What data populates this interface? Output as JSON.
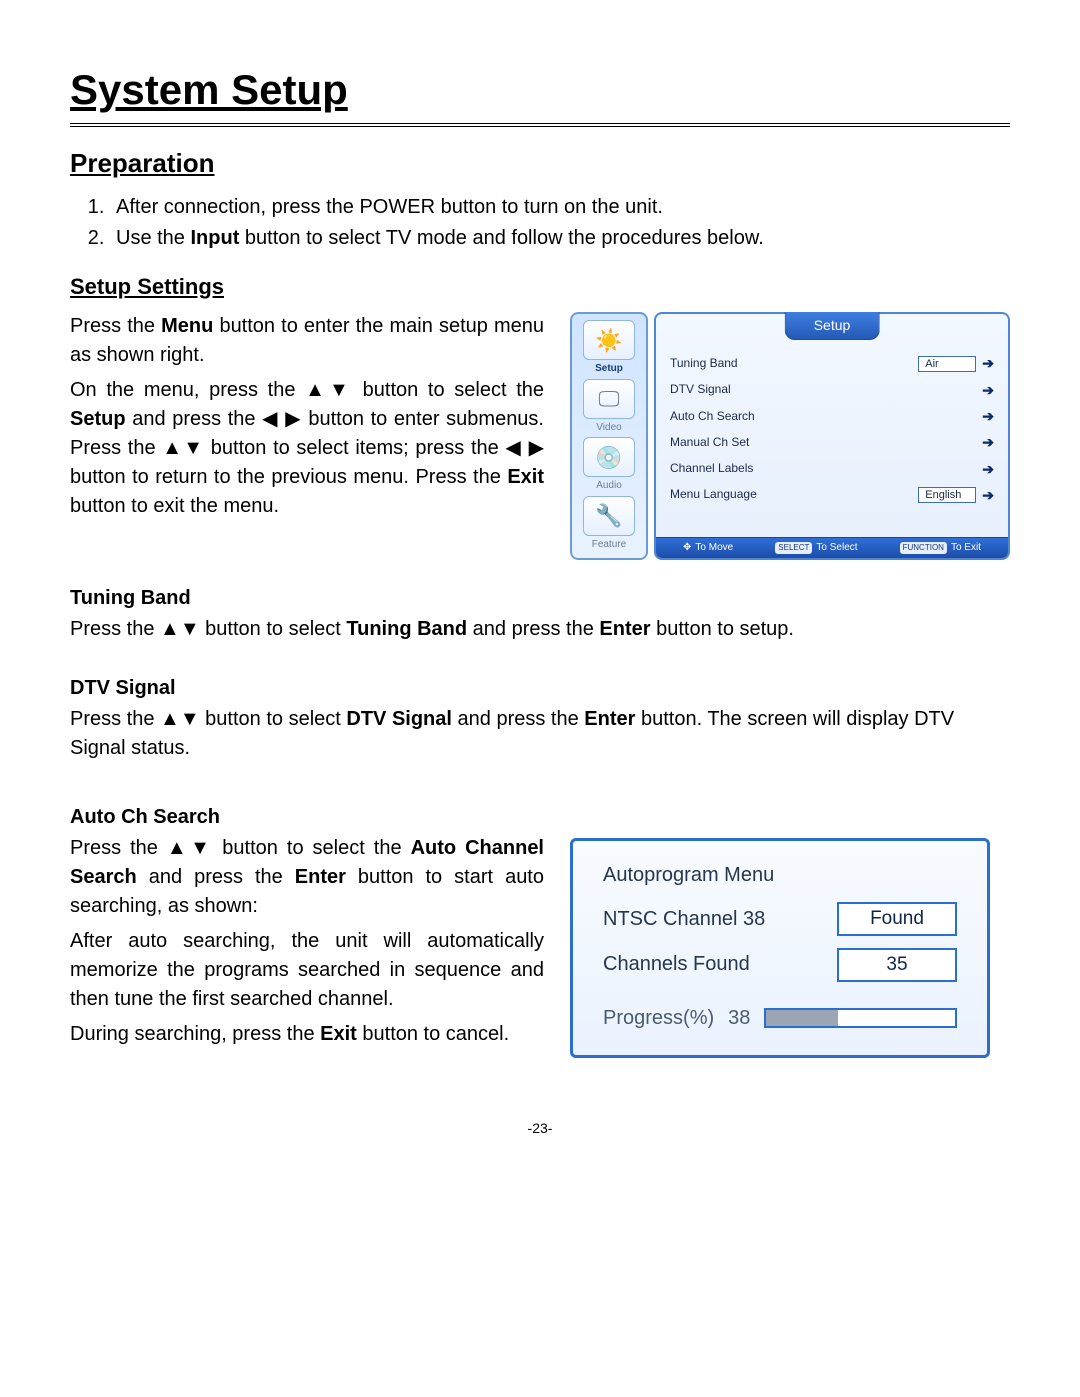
{
  "page": {
    "title": "System Setup",
    "heading_preparation": "Preparation",
    "steps": {
      "s1": "After connection, press the POWER button to turn on the unit.",
      "s2_a": "Use the ",
      "s2_b": "Input",
      "s2_c": " button to select TV mode and follow the procedures below."
    },
    "heading_setup_settings": "Setup Settings",
    "intro_p1_a": "Press the ",
    "intro_p1_b": "Menu",
    "intro_p1_c": " button to enter the main setup menu as shown right.",
    "intro_p2_a": "On the menu, press the ▲▼ button to select the ",
    "intro_p2_b": "Setup",
    "intro_p2_c": " and press the ◀ ▶ button to enter submenus. Press the ▲▼ button to select items; press the ◀ ▶ button to return to the previous menu. Press the ",
    "intro_p2_d": "Exit",
    "intro_p2_e": " button to exit the menu.",
    "sub_tuning_band_head": "Tuning Band",
    "sub_tuning_band_a": "Press the ▲▼ button to select ",
    "sub_tuning_band_b": "Tuning Band",
    "sub_tuning_band_c": " and press the ",
    "sub_tuning_band_d": "Enter",
    "sub_tuning_band_e": " button to setup.",
    "sub_dtv_head": "DTV Signal",
    "sub_dtv_a": "Press the ▲▼ button to select ",
    "sub_dtv_b": "DTV Signal",
    "sub_dtv_c": " and press the ",
    "sub_dtv_d": "Enter",
    "sub_dtv_e": " button. The screen will display DTV Signal status.",
    "sub_auto_head": "Auto Ch Search",
    "sub_auto_p1_a": "Press the ▲▼ button to select the ",
    "sub_auto_p1_b": "Auto Channel Search",
    "sub_auto_p1_c": " and press the ",
    "sub_auto_p1_d": "Enter",
    "sub_auto_p1_e": " button to start auto searching, as shown:",
    "sub_auto_p2": "After auto searching, the unit will automatically memorize the programs searched in sequence and then tune the first searched channel.",
    "sub_auto_p3_a": "During searching, press the ",
    "sub_auto_p3_b": "Exit",
    "sub_auto_p3_c": " button to cancel.",
    "page_number": "-23-"
  },
  "osd": {
    "title": "Setup",
    "side": {
      "setup": "Setup",
      "video": "Video",
      "audio": "Audio",
      "feature": "Feature"
    },
    "rows": {
      "r0": {
        "label": "Tuning Band",
        "value": "Air"
      },
      "r1": {
        "label": "DTV Signal"
      },
      "r2": {
        "label": "Auto Ch Search"
      },
      "r3": {
        "label": "Manual Ch Set"
      },
      "r4": {
        "label": "Channel Labels"
      },
      "r5": {
        "label": "Menu Language",
        "value": "English"
      }
    },
    "footer": {
      "move": "To Move",
      "select_tag": "SELECT",
      "select": "To Select",
      "exit_tag": "FUNCTION",
      "exit": "To Exit"
    }
  },
  "autoprogram": {
    "title": "Autoprogram Menu",
    "channel_label": "NTSC Channel 38",
    "channel_status": "Found",
    "found_label": "Channels Found",
    "found_value": "35",
    "progress_label": "Progress(%)",
    "progress_value": "38",
    "progress_percent": 38
  }
}
